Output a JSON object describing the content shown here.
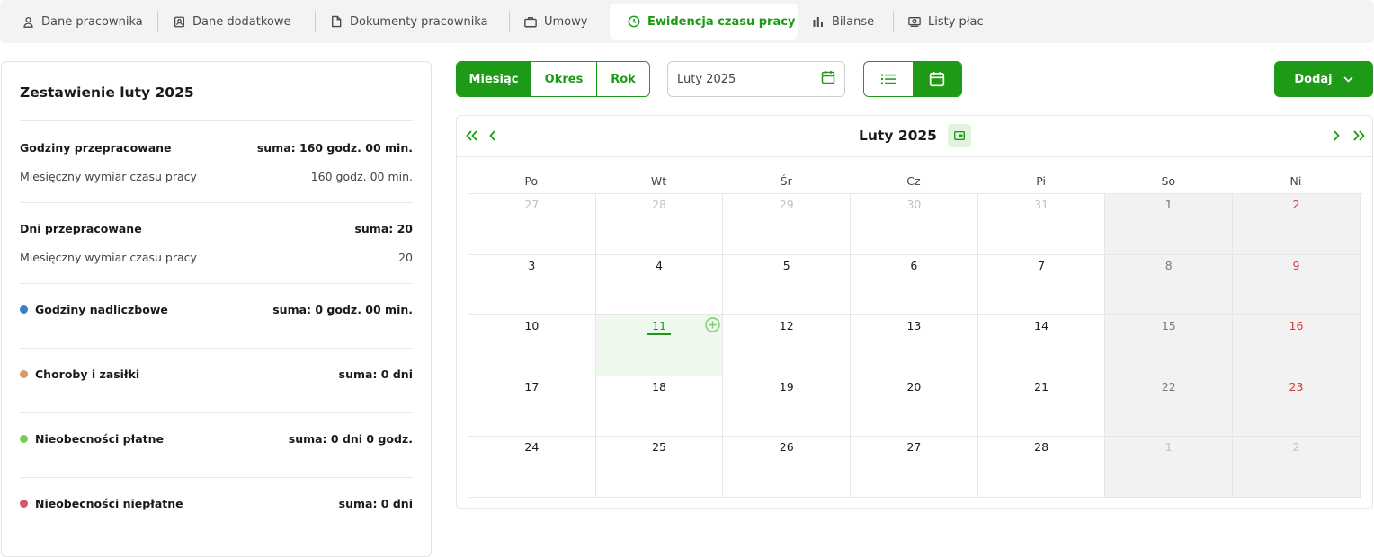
{
  "tabs": [
    {
      "label": "Dane pracownika",
      "icon": "user-icon"
    },
    {
      "label": "Dane dodatkowe",
      "icon": "id-card-icon"
    },
    {
      "label": "Dokumenty pracownika",
      "icon": "document-icon"
    },
    {
      "label": "Umowy",
      "icon": "briefcase-icon"
    },
    {
      "label": "Ewidencja czasu pracy",
      "icon": "clock-icon",
      "active": true
    },
    {
      "label": "Bilanse",
      "icon": "bar-chart-icon"
    },
    {
      "label": "Listy płac",
      "icon": "payroll-icon"
    }
  ],
  "summary": {
    "title": "Zestawienie luty 2025",
    "hours_worked": {
      "label": "Godziny przepracowane",
      "value": "suma: 160 godz. 00 min."
    },
    "hours_norm": {
      "label": "Miesięczny wymiar czasu pracy",
      "value": "160 godz. 00 min."
    },
    "days_worked": {
      "label": "Dni przepracowane",
      "value": "suma: 20"
    },
    "days_norm": {
      "label": "Miesięczny wymiar czasu pracy",
      "value": "20"
    },
    "overtime": {
      "label": "Godziny nadliczbowe",
      "value": "suma: 0 godz. 00 min.",
      "color": "#3a7fc8"
    },
    "sickness": {
      "label": "Choroby i zasiłki",
      "value": "suma: 0 dni",
      "color": "#d99a66"
    },
    "paid_absence": {
      "label": "Nieobecności płatne",
      "value": "suma: 0 dni 0 godz.",
      "color": "#7ac95a"
    },
    "unpaid_absence": {
      "label": "Nieobecności niepłatne",
      "value": "suma: 0 dni",
      "color": "#d9536a"
    }
  },
  "toolbar": {
    "period_modes": [
      "Miesiąc",
      "Okres",
      "Rok"
    ],
    "active_mode": "Miesiąc",
    "date_value": "Luty 2025",
    "add_label": "Dodaj"
  },
  "calendar": {
    "title": "Luty 2025",
    "weekdays": [
      "Po",
      "Wt",
      "Śr",
      "Cz",
      "Pi",
      "So",
      "Ni"
    ],
    "weeks": [
      [
        "27",
        "28",
        "29",
        "30",
        "31",
        "1",
        "2"
      ],
      [
        "3",
        "4",
        "5",
        "6",
        "7",
        "8",
        "9"
      ],
      [
        "10",
        "11",
        "12",
        "13",
        "14",
        "15",
        "16"
      ],
      [
        "17",
        "18",
        "19",
        "20",
        "21",
        "22",
        "23"
      ],
      [
        "24",
        "25",
        "26",
        "27",
        "28",
        "1",
        "2"
      ]
    ],
    "other_month": [
      [
        0,
        0
      ],
      [
        0,
        1
      ],
      [
        0,
        2
      ],
      [
        0,
        3
      ],
      [
        0,
        4
      ],
      [
        4,
        5
      ],
      [
        4,
        6
      ]
    ],
    "today": "11"
  },
  "colors": {
    "accent": "#1e9b16",
    "holiday": "#d33a3a"
  }
}
